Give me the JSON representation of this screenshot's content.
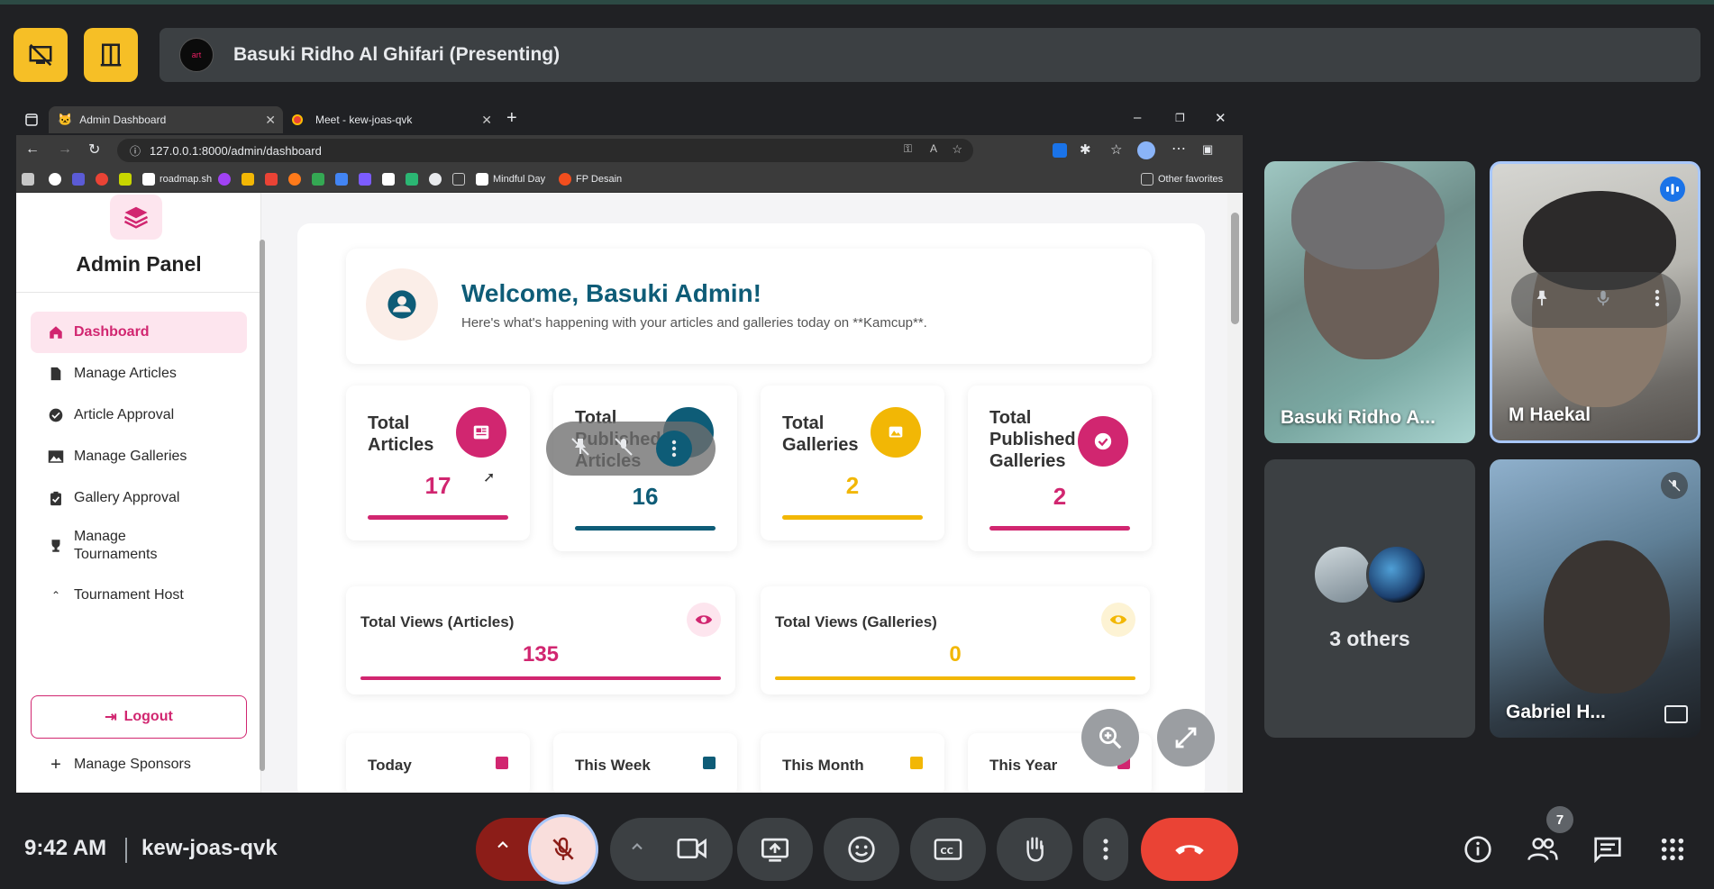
{
  "meet": {
    "presenter_name": "Basuki Ridho Al Ghifari (Presenting)",
    "presenter_avatar_text": "art",
    "clock": "9:42 AM",
    "meeting_code": "kew-joas-qvk",
    "people_count": "7",
    "accent_end_call": "#ea4335",
    "accent_mic_muted": "#f9dedc"
  },
  "browser": {
    "tabs": [
      {
        "title": "Admin Dashboard",
        "icon": "cat-icon"
      },
      {
        "title": "Meet - kew-joas-qvk",
        "icon": "meet-icon"
      }
    ],
    "url": "127.0.0.1:8000/admin/dashboard",
    "bookmarks": [
      {
        "label": "roadmap.sh"
      },
      {
        "label": "Mindful Day"
      },
      {
        "label": "FP Desain"
      }
    ],
    "other_favorites": "Other favorites"
  },
  "sidebar": {
    "title": "Admin Panel",
    "items": [
      {
        "label": "Dashboard",
        "icon": "home-icon"
      },
      {
        "label": "Manage Articles",
        "icon": "document-icon"
      },
      {
        "label": "Article Approval",
        "icon": "check-circle-icon"
      },
      {
        "label": "Manage Galleries",
        "icon": "image-icon"
      },
      {
        "label": "Gallery Approval",
        "icon": "clipboard-check-icon"
      },
      {
        "label": "Manage Tournaments",
        "icon": "trophy-icon"
      },
      {
        "label": "Tournament Host",
        "icon": "host-icon"
      },
      {
        "label": "Manage Sponsors",
        "icon": "plus-icon"
      }
    ],
    "logout_label": "Logout"
  },
  "dashboard": {
    "welcome_title": "Welcome, Basuki Admin!",
    "welcome_sub": "Here's what's happening with your articles and galleries today on **Kamcup**.",
    "stats": [
      {
        "label": "Total Articles",
        "value": "17",
        "color": "#d12670"
      },
      {
        "label": "Total Published Articles",
        "value": "16",
        "color": "#0e5c77"
      },
      {
        "label": "Total Galleries",
        "value": "2",
        "color": "#f2b705"
      },
      {
        "label": "Total Published Galleries",
        "value": "2",
        "color": "#d12670"
      }
    ],
    "views": [
      {
        "label": "Total Views (Articles)",
        "value": "135",
        "color": "#d12670"
      },
      {
        "label": "Total Views (Galleries)",
        "value": "0",
        "color": "#f2b705"
      }
    ],
    "periods": [
      {
        "label": "Today",
        "color": "#d12670"
      },
      {
        "label": "This Week",
        "color": "#0e5c77"
      },
      {
        "label": "This Month",
        "color": "#f2b705"
      },
      {
        "label": "This Year",
        "color": "#d12670"
      }
    ]
  },
  "participants": [
    {
      "name": "Basuki Ridho A..."
    },
    {
      "name": "M Haekal"
    },
    {
      "name": "3 others"
    },
    {
      "name": "Gabriel H..."
    }
  ]
}
